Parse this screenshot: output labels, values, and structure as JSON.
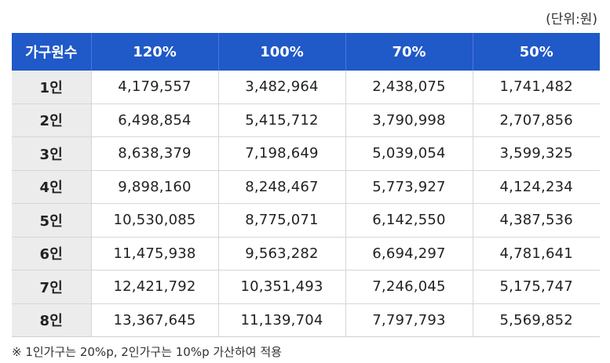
{
  "unit_label": "(단위:원)",
  "table": {
    "headers": [
      "가구원수",
      "120%",
      "100%",
      "70%",
      "50%"
    ],
    "rows": [
      [
        "1인",
        "4,179,557",
        "3,482,964",
        "2,438,075",
        "1,741,482"
      ],
      [
        "2인",
        "6,498,854",
        "5,415,712",
        "3,790,998",
        "2,707,856"
      ],
      [
        "3인",
        "8,638,379",
        "7,198,649",
        "5,039,054",
        "3,599,325"
      ],
      [
        "4인",
        "9,898,160",
        "8,248,467",
        "5,773,927",
        "4,124,234"
      ],
      [
        "5인",
        "10,530,085",
        "8,775,071",
        "6,142,550",
        "4,387,536"
      ],
      [
        "6인",
        "11,475,938",
        "9,563,282",
        "6,694,297",
        "4,781,641"
      ],
      [
        "7인",
        "12,421,792",
        "10,351,493",
        "7,246,045",
        "5,175,747"
      ],
      [
        "8인",
        "13,367,645",
        "11,139,704",
        "7,797,793",
        "5,569,852"
      ]
    ]
  },
  "footnote": "※ 1인가구는 20%p, 2인가구는 10%p 가산하여 적용",
  "colors": {
    "header_bg": "#2059c8",
    "row_header_bg": "#ececec"
  }
}
